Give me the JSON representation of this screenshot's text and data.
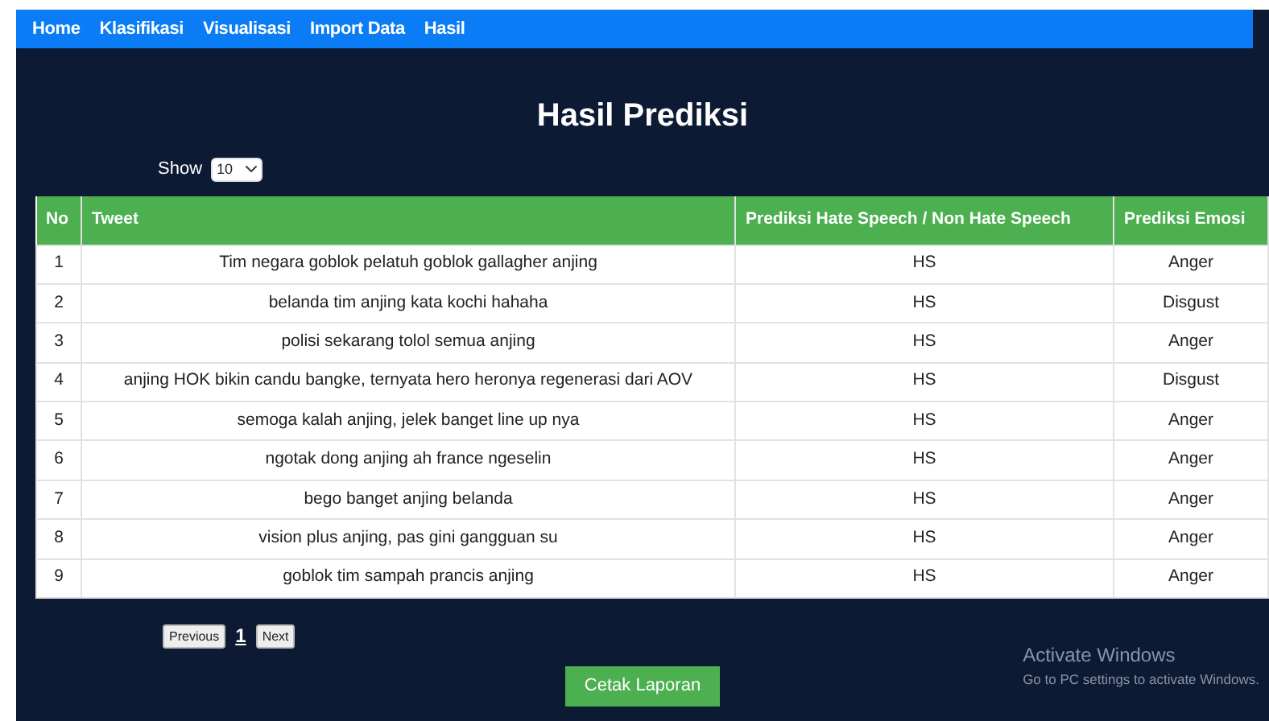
{
  "nav": [
    {
      "label": "Home"
    },
    {
      "label": "Klasifikasi"
    },
    {
      "label": "Visualisasi"
    },
    {
      "label": "Import Data"
    },
    {
      "label": "Hasil"
    }
  ],
  "title": "Hasil Prediksi",
  "length_control": {
    "label": "Show",
    "value": "10"
  },
  "table": {
    "columns": [
      "No",
      "Tweet",
      "Prediksi Hate Speech / Non Hate Speech",
      "Prediksi Emosi"
    ],
    "rows": [
      [
        "1",
        "Tim negara goblok pelatuh goblok gallagher anjing",
        "HS",
        "Anger"
      ],
      [
        "2",
        "belanda tim anjing kata kochi hahaha",
        "HS",
        "Disgust"
      ],
      [
        "3",
        "polisi sekarang tolol semua anjing",
        "HS",
        "Anger"
      ],
      [
        "4",
        "anjing HOK bikin candu bangke, ternyata hero heronya regenerasi dari AOV",
        "HS",
        "Disgust"
      ],
      [
        "5",
        "semoga kalah anjing, jelek banget line up nya",
        "HS",
        "Anger"
      ],
      [
        "6",
        "ngotak dong anjing ah france ngeselin",
        "HS",
        "Anger"
      ],
      [
        "7",
        "bego banget anjing belanda",
        "HS",
        "Anger"
      ],
      [
        "8",
        "vision plus anjing, pas gini gangguan su",
        "HS",
        "Anger"
      ],
      [
        "9",
        "goblok tim sampah prancis anjing",
        "HS",
        "Anger"
      ]
    ]
  },
  "pagination": {
    "previous": "Previous",
    "page": "1",
    "next": "Next"
  },
  "print_button": "Cetak Laporan",
  "os_notice": {
    "title": "Activate Windows",
    "text": "Go to PC settings to activate Windows."
  }
}
